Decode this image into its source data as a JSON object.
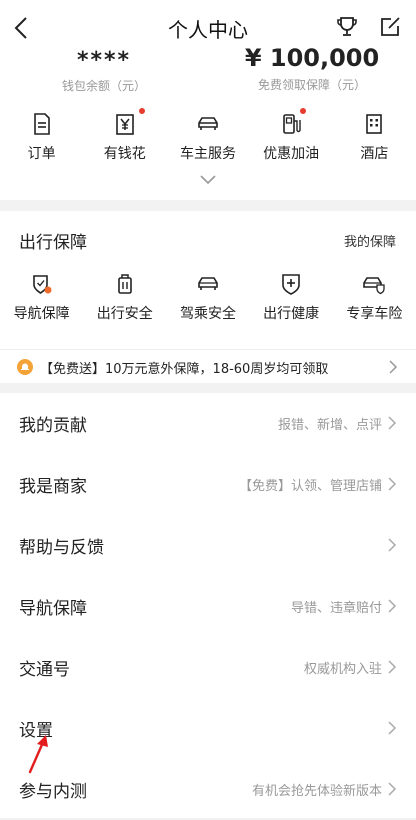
{
  "header": {
    "title": "个人中心",
    "icons": [
      "back-icon",
      "trophy-icon",
      "edit-icon"
    ]
  },
  "wallet": {
    "balance": "****",
    "balance_label": "钱包余额（元）",
    "guarantee": "¥ 100,000",
    "guarantee_label": "免费领取保障（元）"
  },
  "quick": [
    {
      "label": "订单",
      "icon": "document-icon",
      "dot": false
    },
    {
      "label": "有钱花",
      "icon": "yen-icon",
      "dot": true
    },
    {
      "label": "车主服务",
      "icon": "car-icon",
      "dot": false
    },
    {
      "label": "优惠加油",
      "icon": "fuel-icon",
      "dot": true
    },
    {
      "label": "酒店",
      "icon": "hotel-icon",
      "dot": false
    }
  ],
  "trip": {
    "title": "出行保障",
    "link": "我的保障",
    "items": [
      {
        "label": "导航保障",
        "icon": "nav-shield-icon"
      },
      {
        "label": "出行安全",
        "icon": "luggage-icon"
      },
      {
        "label": "驾乘安全",
        "icon": "car-icon"
      },
      {
        "label": "出行健康",
        "icon": "health-icon"
      },
      {
        "label": "专享车险",
        "icon": "car-shield-icon"
      }
    ],
    "promo": "【免费送】10万元意外保障，18-60周岁均可领取"
  },
  "menu": [
    {
      "label": "我的贡献",
      "hint": "报错、新增、点评"
    },
    {
      "label": "我是商家",
      "hint": "【免费】认领、管理店铺"
    },
    {
      "label": "帮助与反馈",
      "hint": ""
    },
    {
      "label": "导航保障",
      "hint": "导错、违章赔付"
    },
    {
      "label": "交通号",
      "hint": "权威机构入驻"
    },
    {
      "label": "设置",
      "hint": ""
    },
    {
      "label": "参与内测",
      "hint": "有机会抢先体验新版本"
    }
  ],
  "colors": {
    "accent": "#e63b2e",
    "promo_bell": "#f3a338"
  }
}
